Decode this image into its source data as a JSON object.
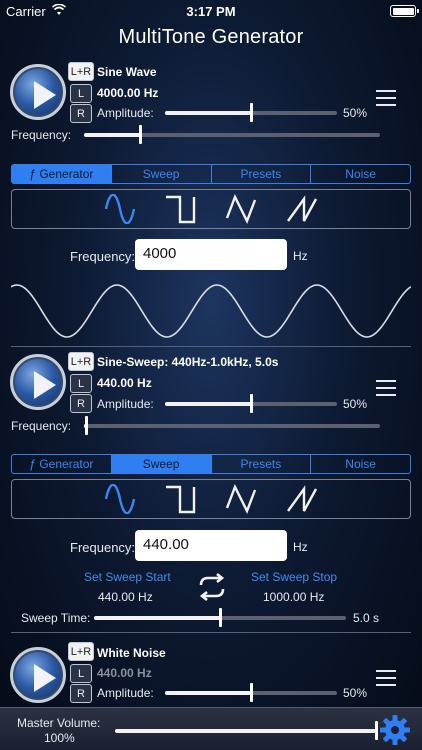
{
  "status": {
    "carrier": "Carrier",
    "time": "3:17 PM"
  },
  "app_title": "MultiTone Generator",
  "channels": [
    {
      "lr": "L+R",
      "l": "L",
      "r": "R",
      "name": "Sine Wave",
      "hz": "4000.00 Hz",
      "amplitude_label": "Amplitude:",
      "amplitude_value": "50%",
      "amplitude_level": 0.5,
      "frequency_label": "Frequency:",
      "frequency_level": 0.19
    },
    {
      "lr": "L+R",
      "l": "L",
      "r": "R",
      "name": "Sine-Sweep: 440Hz-1.0kHz, 5.0s",
      "hz": "440.00 Hz",
      "amplitude_label": "Amplitude:",
      "amplitude_value": "50%",
      "amplitude_level": 0.5,
      "frequency_label": "Frequency:",
      "frequency_level": 0.01
    },
    {
      "lr": "L+R",
      "l": "L",
      "r": "R",
      "name": "White Noise",
      "hz": "440.00 Hz",
      "amplitude_label": "Amplitude:",
      "amplitude_value": "50%",
      "amplitude_level": 0.5
    }
  ],
  "tabs": [
    "ƒ Generator",
    "Sweep",
    "Presets",
    "Noise"
  ],
  "panel1": {
    "active_tab": 0,
    "frequency_label": "Frequency:",
    "frequency_value": "4000",
    "unit": "Hz"
  },
  "panel2": {
    "active_tab": 1,
    "frequency_label": "Frequency:",
    "frequency_value": "440.00",
    "unit": "Hz",
    "sweep_start_label": "Set Sweep Start",
    "sweep_start_value": "440.00 Hz",
    "sweep_stop_label": "Set Sweep Stop",
    "sweep_stop_value": "1000.00 Hz",
    "sweep_time_label": "Sweep Time:",
    "sweep_time_value": "5.0 s",
    "sweep_time_level": 0.5
  },
  "waveform_icons": [
    "sine-wave-icon",
    "square-wave-icon",
    "triangle-wave-icon",
    "sawtooth-wave-icon"
  ],
  "master": {
    "label": "Master Volume:",
    "value": "100%",
    "level": 1.0
  },
  "colors": {
    "accent": "#2f7ff3",
    "background": "#0d1a33"
  }
}
